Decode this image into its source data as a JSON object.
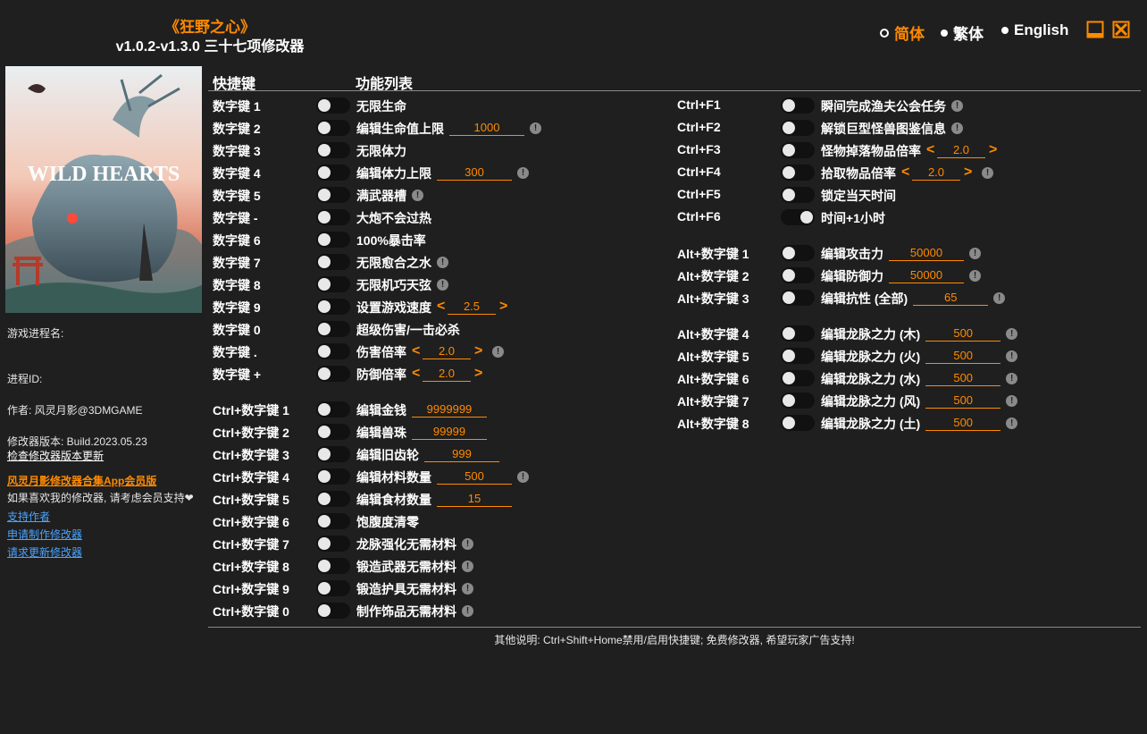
{
  "header": {
    "game_title": "《狂野之心》",
    "version_title": "v1.0.2-v1.3.0 三十七项修改器"
  },
  "languages": [
    {
      "label": "简体",
      "active": true
    },
    {
      "label": "繁体",
      "active": false
    },
    {
      "label": "English",
      "active": false
    }
  ],
  "window_controls": [
    {
      "name": "minimize-icon"
    },
    {
      "name": "close-icon"
    }
  ],
  "cover": {
    "logo_text": "WILD HEARTS"
  },
  "sidebar": {
    "process_name_label": "游戏进程名:",
    "process_id_label": "进程ID:",
    "author": "作者: 风灵月影@3DMGAME",
    "trainer_version": "修改器版本: Build.2023.05.23",
    "check_update": "检查修改器版本更新",
    "promo": "风灵月影修改器合集App会员版",
    "support_text": "如果喜欢我的修改器, 请考虑会员支持❤",
    "links": [
      "支持作者",
      "申请制作修改器",
      "请求更新修改器"
    ]
  },
  "columns": {
    "hotkey": "快捷键",
    "features": "功能列表"
  },
  "accent_color": "#ff8a00",
  "left_options": [
    {
      "hotkey": "数字键 1",
      "name": "无限生命",
      "on": false
    },
    {
      "hotkey": "数字键 2",
      "name": "编辑生命值上限",
      "on": false,
      "value": "1000",
      "info": true
    },
    {
      "hotkey": "数字键 3",
      "name": "无限体力",
      "on": false
    },
    {
      "hotkey": "数字键 4",
      "name": "编辑体力上限",
      "on": false,
      "value": "300",
      "info": true
    },
    {
      "hotkey": "数字键 5",
      "name": "满武器槽",
      "on": false,
      "info": true
    },
    {
      "hotkey": "数字键 -",
      "name": "大炮不会过热",
      "on": false
    },
    {
      "hotkey": "数字键 6",
      "name": "100%暴击率",
      "on": false
    },
    {
      "hotkey": "数字键 7",
      "name": "无限愈合之水",
      "on": false,
      "info": true
    },
    {
      "hotkey": "数字键 8",
      "name": "无限机巧天弦",
      "on": false,
      "info": true
    },
    {
      "hotkey": "数字键 9",
      "name": "设置游戏速度",
      "on": false,
      "stepper": "2.5"
    },
    {
      "hotkey": "数字键 0",
      "name": "超级伤害/一击必杀",
      "on": false
    },
    {
      "hotkey": "数字键 .",
      "name": "伤害倍率",
      "on": false,
      "stepper": "2.0",
      "info": true
    },
    {
      "hotkey": "数字键 +",
      "name": "防御倍率",
      "on": false,
      "stepper": "2.0"
    },
    {
      "hotkey": "Ctrl+数字键 1",
      "name": "编辑金钱",
      "on": false,
      "value": "9999999",
      "gap": true
    },
    {
      "hotkey": "Ctrl+数字键 2",
      "name": "编辑兽珠",
      "on": false,
      "value": "99999"
    },
    {
      "hotkey": "Ctrl+数字键 3",
      "name": "编辑旧齿轮",
      "on": false,
      "value": "999"
    },
    {
      "hotkey": "Ctrl+数字键 4",
      "name": "编辑材料数量",
      "on": false,
      "value": "500",
      "info": true
    },
    {
      "hotkey": "Ctrl+数字键 5",
      "name": "编辑食材数量",
      "on": false,
      "value": "15"
    },
    {
      "hotkey": "Ctrl+数字键 6",
      "name": "饱腹度清零",
      "on": false
    },
    {
      "hotkey": "Ctrl+数字键 7",
      "name": "龙脉强化无需材料",
      "on": false,
      "info": true
    },
    {
      "hotkey": "Ctrl+数字键 8",
      "name": "锻造武器无需材料",
      "on": false,
      "info": true
    },
    {
      "hotkey": "Ctrl+数字键 9",
      "name": "锻造护具无需材料",
      "on": false,
      "info": true
    },
    {
      "hotkey": "Ctrl+数字键 0",
      "name": "制作饰品无需材料",
      "on": false,
      "info": true
    }
  ],
  "right_options": [
    {
      "hotkey": "Ctrl+F1",
      "name": "瞬间完成渔夫公会任务",
      "on": false,
      "info": true
    },
    {
      "hotkey": "Ctrl+F2",
      "name": "解锁巨型怪兽图鉴信息",
      "on": false,
      "info": true
    },
    {
      "hotkey": "Ctrl+F3",
      "name": "怪物掉落物品倍率",
      "on": false,
      "stepper": "2.0"
    },
    {
      "hotkey": "Ctrl+F4",
      "name": "拾取物品倍率",
      "on": false,
      "stepper": "2.0",
      "info": true
    },
    {
      "hotkey": "Ctrl+F5",
      "name": "锁定当天时间",
      "on": false
    },
    {
      "hotkey": "Ctrl+F6",
      "name": "时间+1小时",
      "on": true
    },
    {
      "hotkey": "Alt+数字键 1",
      "name": "编辑攻击力",
      "on": false,
      "value": "50000",
      "info": true,
      "gap": true
    },
    {
      "hotkey": "Alt+数字键 2",
      "name": "编辑防御力",
      "on": false,
      "value": "50000",
      "info": true
    },
    {
      "hotkey": "Alt+数字键 3",
      "name": "编辑抗性 (全部)",
      "on": false,
      "value": "65",
      "info": true
    },
    {
      "hotkey": "Alt+数字键 4",
      "name": "编辑龙脉之力 (木)",
      "on": false,
      "value": "500",
      "info": true,
      "gap": true
    },
    {
      "hotkey": "Alt+数字键 5",
      "name": "编辑龙脉之力 (火)",
      "on": false,
      "value": "500",
      "info": true
    },
    {
      "hotkey": "Alt+数字键 6",
      "name": "编辑龙脉之力 (水)",
      "on": false,
      "value": "500",
      "info": true
    },
    {
      "hotkey": "Alt+数字键 7",
      "name": "编辑龙脉之力 (风)",
      "on": false,
      "value": "500",
      "info": true
    },
    {
      "hotkey": "Alt+数字键 8",
      "name": "编辑龙脉之力 (土)",
      "on": false,
      "value": "500",
      "info": true
    }
  ],
  "footer": {
    "note": "其他说明: Ctrl+Shift+Home禁用/启用快捷键; 免费修改器, 希望玩家广告支持!"
  }
}
